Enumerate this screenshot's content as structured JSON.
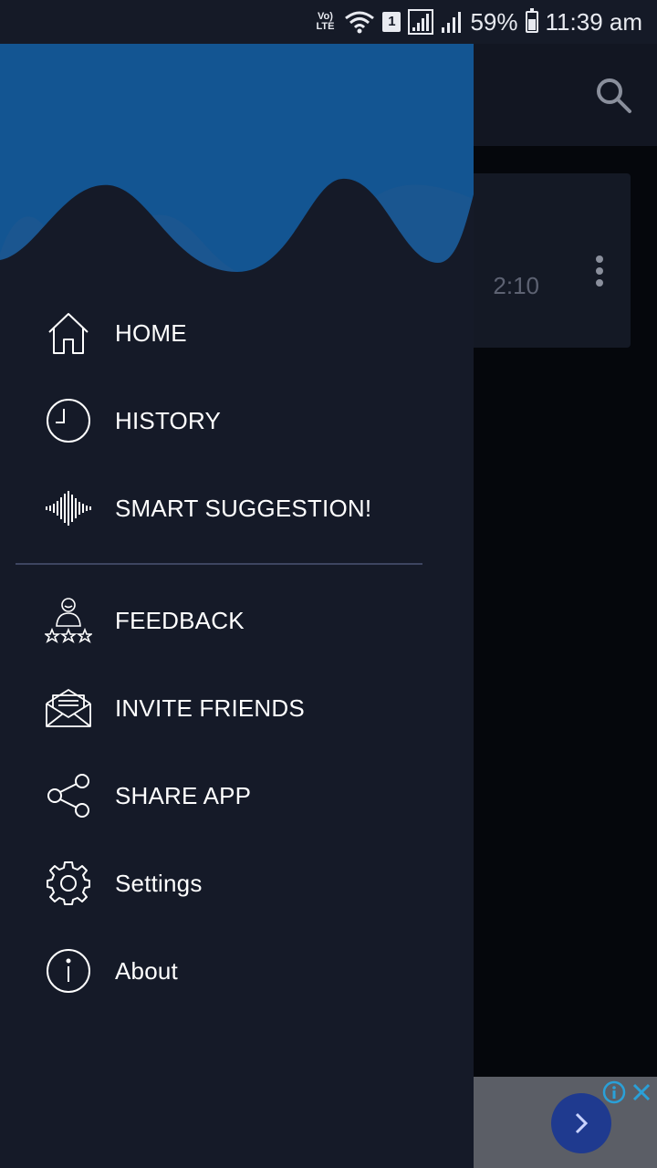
{
  "status_bar": {
    "volte_label": "Vo)\nLTE",
    "sim_slot": "1",
    "battery_percent": "59%",
    "time": "11:39 am"
  },
  "background_app": {
    "card_duration": "2:10",
    "search_icon": "search-icon",
    "more_icon": "more-vertical-icon"
  },
  "ad": {
    "next_icon": "chevron-right-icon",
    "info_icon": "info-icon",
    "close_icon": "close-icon"
  },
  "drawer": {
    "header_colors": {
      "top": "#135592",
      "wave_back": "#1e5b97",
      "body": "#151a28"
    },
    "primary_items": [
      {
        "label": "HOME",
        "icon": "home-icon"
      },
      {
        "label": "HISTORY",
        "icon": "clock-icon"
      },
      {
        "label": "SMART SUGGESTION!",
        "icon": "sound-wave-icon"
      }
    ],
    "secondary_items": [
      {
        "label": "FEEDBACK",
        "icon": "rating-user-icon"
      },
      {
        "label": "INVITE FRIENDS",
        "icon": "envelope-open-icon"
      },
      {
        "label": "SHARE APP",
        "icon": "share-icon"
      },
      {
        "label": "Settings",
        "icon": "gear-icon"
      },
      {
        "label": "About",
        "icon": "info-circle-icon"
      }
    ]
  }
}
